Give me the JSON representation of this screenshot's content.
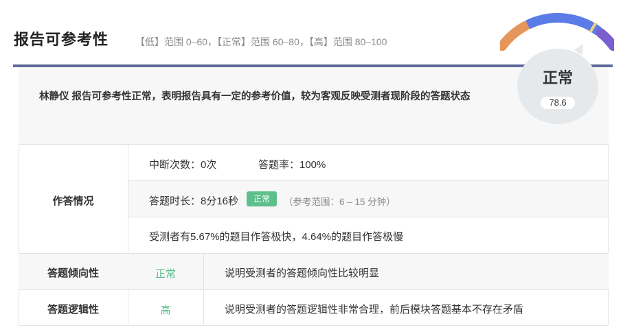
{
  "header": {
    "title": "报告可参考性",
    "range_text": "【低】范围 0–60，【正常】范围 60–80，【高】范围 80–100"
  },
  "summary": {
    "text": "林静仪 报告可参考性正常，表明报告具有一定的参考价值，较为客观反映受测者现阶段的答题状态"
  },
  "gauge": {
    "status": "正常",
    "score": "78.6",
    "level": 78.6,
    "scale_min": 0,
    "scale_max": 100,
    "colors": {
      "low": "#e5965a",
      "normal": "#5b7ce6",
      "high": "#7a5fcf",
      "marker": "#f0d27a"
    }
  },
  "answering": {
    "label": "作答情况",
    "interruptions": "中断次数：0次",
    "answer_rate": "答题率：100%",
    "duration": "答题时长：8分16秒",
    "duration_badge": "正常",
    "duration_reference": "（参考范围：6 – 15 分钟）",
    "speed_note": "受测者有5.67%的题目作答极快，4.64%的题目作答极慢"
  },
  "tendency": {
    "label": "答题倾向性",
    "value": "正常",
    "description": "说明受测者的答题倾向性比较明显"
  },
  "logic": {
    "label": "答题逻辑性",
    "value": "高",
    "description": "说明受测者的答题逻辑性非常合理，前后模块答题基本不存在矛盾"
  },
  "colors": {
    "accent_rule": "#5f6a9a",
    "badge_green": "#5cbf8c",
    "summary_bg": "#f7f7f7"
  }
}
